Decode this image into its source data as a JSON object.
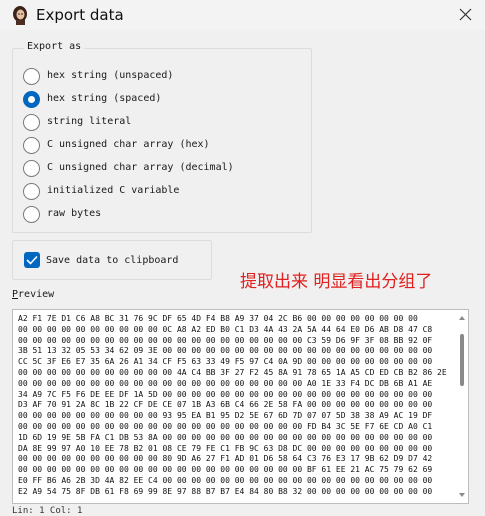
{
  "window": {
    "title": "Export data",
    "icon": "avatar-app-icon",
    "close_icon": "close-icon"
  },
  "export_as": {
    "label": "Export as",
    "options": [
      {
        "label": "hex string (unspaced)",
        "checked": false
      },
      {
        "label": "hex string (spaced)",
        "checked": true
      },
      {
        "label": "string literal",
        "checked": false
      },
      {
        "label": "C unsigned char array (hex)",
        "checked": false
      },
      {
        "label": "C unsigned char array (decimal)",
        "checked": false
      },
      {
        "label": "initialized C variable",
        "checked": false
      },
      {
        "label": "raw bytes",
        "checked": false
      }
    ]
  },
  "clipboard": {
    "label": "Save data to clipboard",
    "checked": true
  },
  "annotation": "提取出来 明显看出分组了",
  "preview": {
    "label_underlined": "P",
    "label_rest": "review",
    "lines": [
      "A2 F1 7E D1 C6 A8 BC 31 76 9C DF 65 4D F4 B8 A9 37 04 2C B6 00 00 00 00 00 00 00 00",
      "00 00 00 00 00 00 00 00 00 00 0C A8 A2 ED B0 C1 D3 4A 43 2A 5A 44 64 E0 D6 AB D8 47 C8",
      "00 00 00 00 00 00 00 00 00 00 00 00 00 00 00 00 00 00 00 00 C3 59 D6 9F 3F 08 BB 92 0F",
      "3B 51 13 32 05 53 34 62 09 3E 00 00 00 00 00 00 00 00 00 00 00 00 00 00 00 00 00 00 00",
      "CC 5C 3F E6 E7 35 6A 26 A1 34 CF F5 63 33 49 F5 97 C4 0A 9D 00 00 00 00 00 00 00 00 00",
      "00 00 00 00 00 00 00 00 00 00 00 4A C4 BB 3F 27 F2 45 8A 91 78 65 1A A5 CD ED CB B2 86 2E",
      "00 00 00 00 00 00 00 00 00 00 00 00 00 00 00 00 00 00 00 00 A0 1E 33 F4 DC DB 6B A1 AE",
      "34 A9 7C F5 F6 DE EE DF 1A 5D 00 00 00 00 00 00 00 00 00 00 00 00 00 00 00 00 00 00 00",
      "D3 AF 70 91 2A 8C 1B 22 CF DE CE 07 1B A3 6B C4 66 2E 58 FA 00 00 00 00 00 00 00 00 00",
      "00 00 00 00 00 00 00 00 00 00 93 95 EA B1 95 D2 5E 67 6D 7D 07 07 5D 38 38 A9 AC 19 DF",
      "00 00 00 00 00 00 00 00 00 00 00 00 00 00 00 00 00 00 00 00 FD B4 3C 5E F7 6E CD A0 C1",
      "1D 6D 19 9E 5B FA C1 DB 53 8A 00 00 00 00 00 00 00 00 00 00 00 00 00 00 00 00 00 00 00",
      "DA 8E 99 97 A0 10 EE 78 B2 01 08 CE 79 FE C1 FB 9C 63 D8 DC 00 00 00 00 00 00 00 00 00",
      "00 00 00 00 00 00 00 00 00 00 80 9D A6 27 F1 AD 01 D6 58 64 C3 76 E3 17 9B 62 D9 D7 42",
      "00 00 00 00 00 00 00 00 00 00 00 00 00 00 00 00 00 00 00 00 BF 61 EE 21 AC 75 79 62 69",
      "E0 FF B6 A6 2B 3D 4A 82 EE C4 00 00 00 00 00 00 00 00 00 00 00 00 00 00 00 00 00 00 00",
      "E2 A9 54 75 8F DB 61 F8 69 99 8E 97 88 B7 B7 E4 84 80 B8 32 00 00 00 00 00 00 00 00 00"
    ]
  },
  "status": "Lin: 1  Col: 1"
}
